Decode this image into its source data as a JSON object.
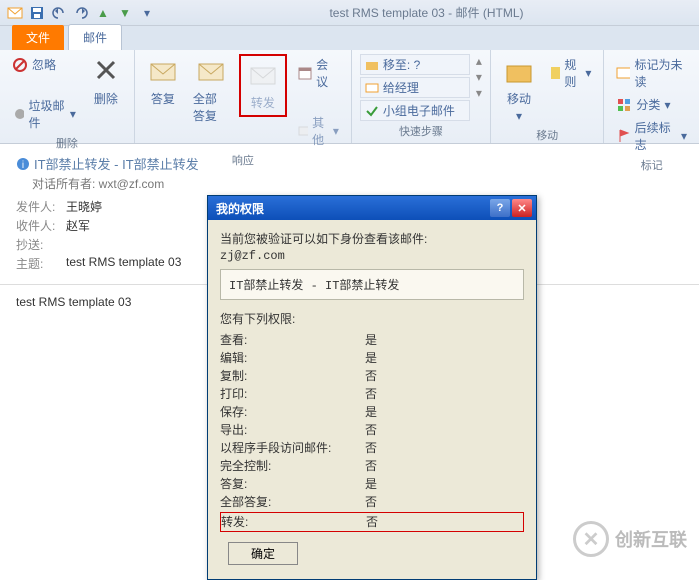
{
  "window_title": "test RMS template 03 - 邮件 (HTML)",
  "tabs": {
    "file": "文件",
    "mail": "邮件"
  },
  "ribbon": {
    "delete_group": {
      "ignore": "忽略",
      "junk": "垃圾邮件",
      "delete": "删除",
      "label": "删除"
    },
    "respond_group": {
      "reply": "答复",
      "reply_all": "全部答复",
      "forward": "转发",
      "meeting": "会议",
      "other": "其他",
      "label": "响应"
    },
    "quicksteps_group": {
      "moveto": "移至: ?",
      "to_mgr": "给经理",
      "team_mail": "小组电子邮件",
      "label": "快速步骤"
    },
    "move_group": {
      "move": "移动",
      "rules": "规则",
      "label": "移动"
    },
    "mark_group": {
      "mark_unread": "标记为未读",
      "categorize": "分类",
      "followup": "后续标志",
      "label": "标记"
    }
  },
  "mail": {
    "restriction": "IT部禁止转发 - IT部禁止转发",
    "owner_label": "对话所有者: ",
    "owner": "wxt@zf.com",
    "from_label": "发件人:",
    "from": "王晓婷",
    "to_label": "收件人:",
    "to": "赵军",
    "cc_label": "抄送:",
    "cc": "",
    "subject_label": "主题:",
    "subject": "test RMS template 03",
    "body": "test RMS template 03"
  },
  "dialog": {
    "title": "我的权限",
    "intro": "当前您被验证可以如下身份查看该邮件:",
    "identity": "zj@zf.com",
    "restriction": "IT部禁止转发 - IT部禁止转发",
    "perm_intro": "您有下列权限:",
    "perms": [
      {
        "k": "查看:",
        "v": "是"
      },
      {
        "k": "编辑:",
        "v": "是"
      },
      {
        "k": "复制:",
        "v": "否"
      },
      {
        "k": "打印:",
        "v": "否"
      },
      {
        "k": "保存:",
        "v": "是"
      },
      {
        "k": "导出:",
        "v": "否"
      },
      {
        "k": "以程序手段访问邮件:",
        "v": "否"
      },
      {
        "k": "完全控制:",
        "v": "否"
      },
      {
        "k": "答复:",
        "v": "是"
      },
      {
        "k": "全部答复:",
        "v": "否"
      }
    ],
    "highlight": {
      "k": "转发:",
      "v": "否"
    },
    "ok": "确定"
  },
  "watermark": "创新互联"
}
